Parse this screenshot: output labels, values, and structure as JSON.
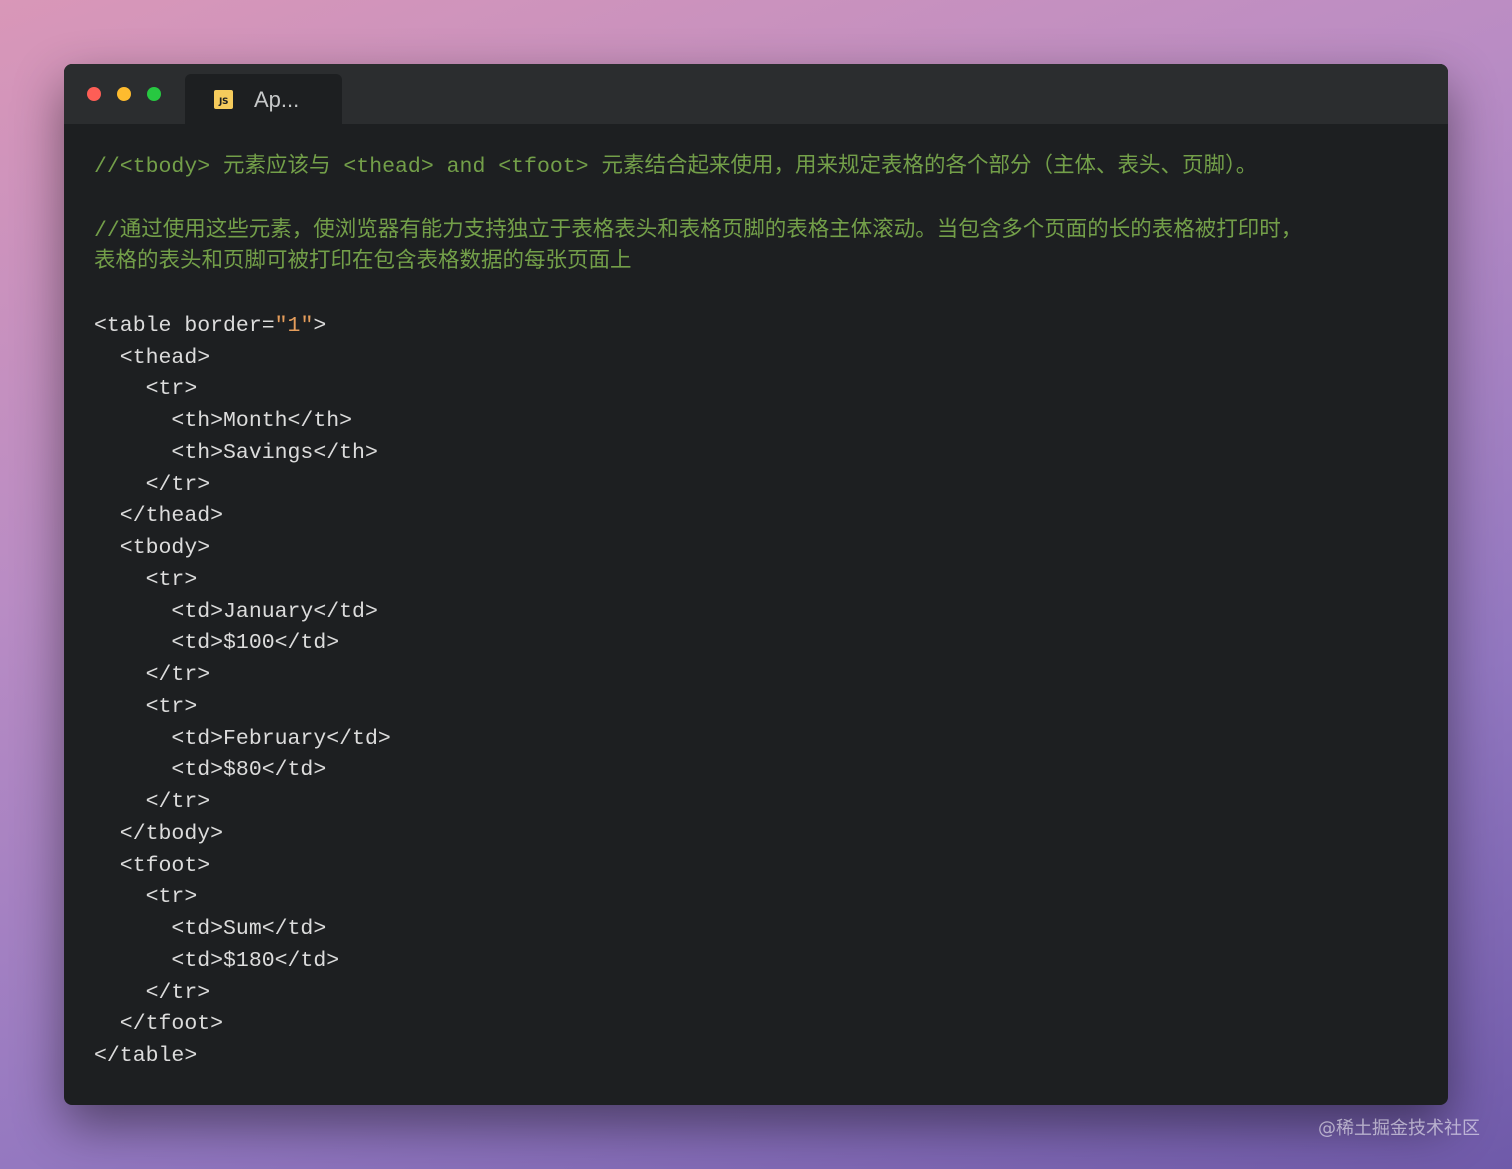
{
  "window": {
    "traffic_lights": {
      "close_color": "#fd5e56",
      "minimize_color": "#febb2e",
      "maximize_color": "#27c841"
    },
    "tab": {
      "icon_text": "JS",
      "icon_color": "#f5cb5c",
      "title": "Ap..."
    }
  },
  "code": {
    "comment_color": "#739f49",
    "string_color": "#e59d5b",
    "comment1": "//<tbody> 元素应该与 <thead> and <tfoot> 元素结合起来使用，用来规定表格的各个部分（主体、表头、页脚）。",
    "comment2_line1": "//通过使用这些元素，使浏览器有能力支持独立于表格表头和表格页脚的表格主体滚动。当包含多个页面的长的表格被打印时，",
    "comment2_line2": "表格的表头和页脚可被打印在包含表格数据的每张页面上",
    "table_open_prefix": "<table border=",
    "border_value": "\"1\"",
    "table_open_suffix": ">",
    "lines": [
      "  <thead>",
      "    <tr>",
      "      <th>Month</th>",
      "      <th>Savings</th>",
      "    </tr>",
      "  </thead>",
      "  <tbody>",
      "    <tr>",
      "      <td>January</td>",
      "      <td>$100</td>",
      "    </tr>",
      "    <tr>",
      "      <td>February</td>",
      "      <td>$80</td>",
      "    </tr>",
      "  </tbody>",
      "  <tfoot>",
      "    <tr>",
      "      <td>Sum</td>",
      "      <td>$180</td>",
      "    </tr>",
      "  </tfoot>",
      "</table>"
    ]
  },
  "watermark": "@稀土掘金技术社区"
}
